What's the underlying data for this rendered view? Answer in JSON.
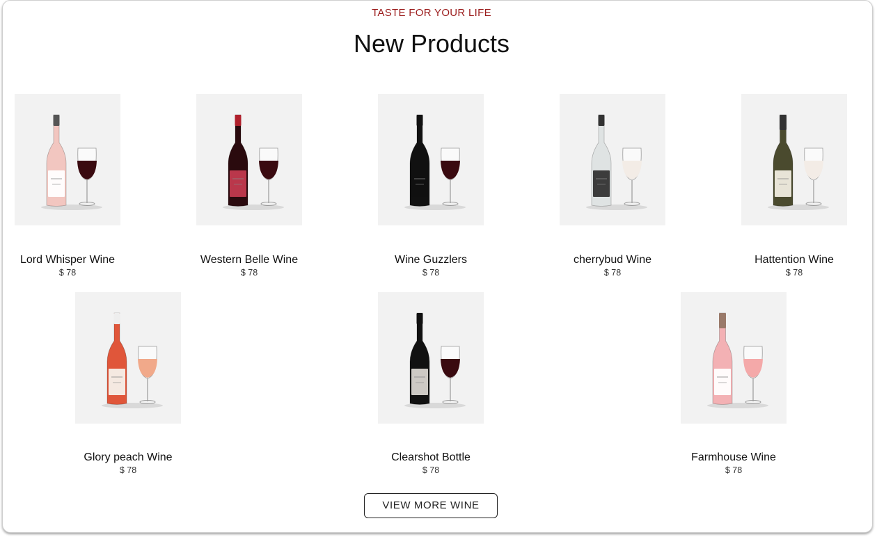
{
  "header": {
    "tagline": "TASTE FOR YOUR LIFE",
    "title": "New Products"
  },
  "products": [
    {
      "name": "Lord Whisper Wine",
      "price": "$ 78",
      "bottle": "rose",
      "glass": "red",
      "bottle_color": "#f2c6c0",
      "label_color": "#ffffff",
      "cap_color": "#555555"
    },
    {
      "name": "Western Belle Wine",
      "price": "$ 78",
      "bottle": "red",
      "glass": "red",
      "bottle_color": "#2a0a0e",
      "label_color": "#c23a4f",
      "cap_color": "#b0202c"
    },
    {
      "name": "Wine Guzzlers",
      "price": "$ 78",
      "bottle": "black",
      "glass": "red",
      "bottle_color": "#111111",
      "label_color": "#111111",
      "cap_color": "#111111"
    },
    {
      "name": "cherrybud Wine",
      "price": "$ 78",
      "bottle": "clear",
      "glass": "white",
      "bottle_color": "#dfe3e3",
      "label_color": "#333333",
      "cap_color": "#333333"
    },
    {
      "name": "Hattention Wine",
      "price": "$ 78",
      "bottle": "sparkling",
      "glass": "white",
      "bottle_color": "#4a4a2e",
      "label_color": "#f0ece0",
      "cap_color": "#333333"
    },
    {
      "name": "Glory peach Wine",
      "price": "$ 78",
      "bottle": "peach",
      "glass": "peach",
      "bottle_color": "#e0563a",
      "label_color": "#f6f1ea",
      "cap_color": "#eeeeee"
    },
    {
      "name": "Clearshot Bottle",
      "price": "$ 78",
      "bottle": "black",
      "glass": "red",
      "bottle_color": "#111111",
      "label_color": "#d8d4cf",
      "cap_color": "#111111"
    },
    {
      "name": "Farmhouse Wine",
      "price": "$ 78",
      "bottle": "pink-sparkling",
      "glass": "pink",
      "bottle_color": "#f3b1b4",
      "label_color": "#ffffff",
      "cap_color": "#9a7a6a"
    }
  ],
  "actions": {
    "view_more_label": "VIEW MORE WINE"
  }
}
